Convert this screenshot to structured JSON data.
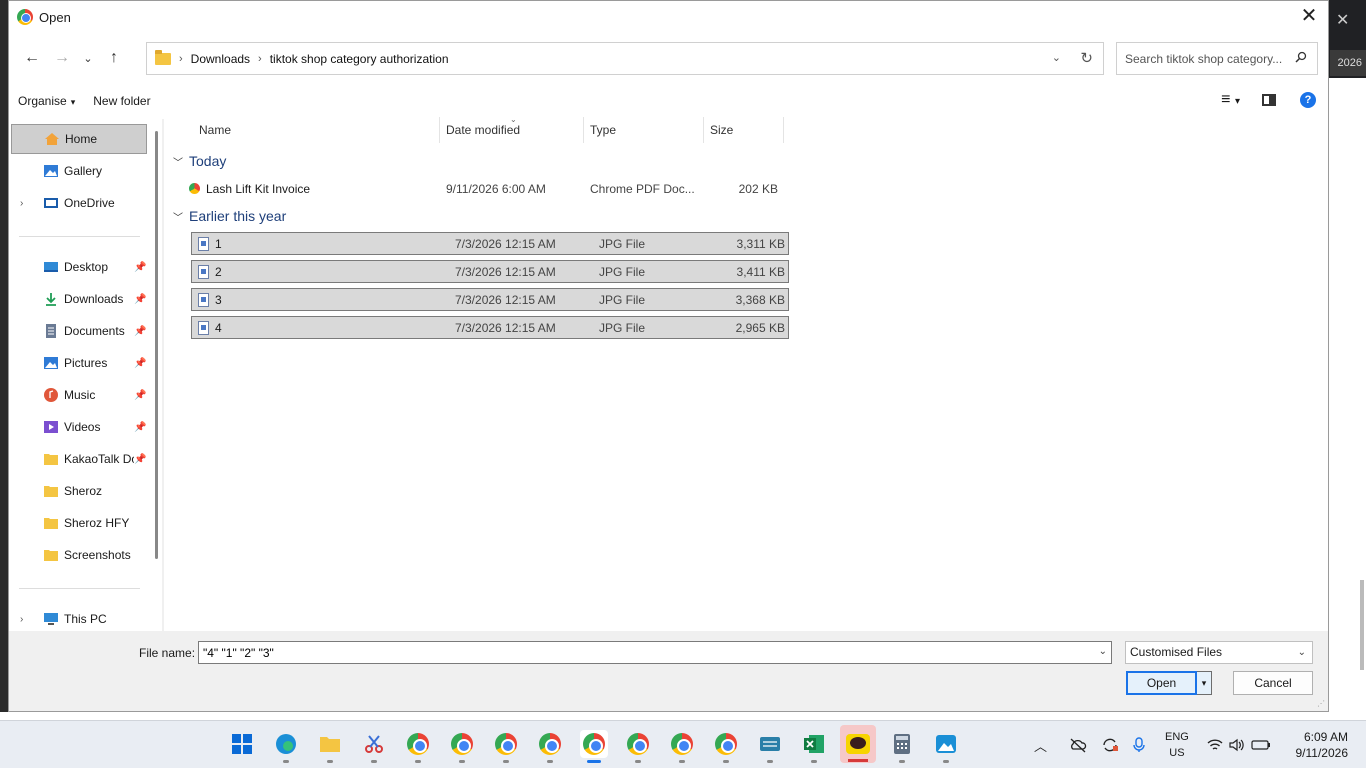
{
  "dialog": {
    "title": "Open",
    "close_glyph": "✕"
  },
  "background": {
    "close_glyph": "✕",
    "year_label": "2026"
  },
  "nav": {
    "back": "←",
    "forward": "→",
    "recent": "⌄",
    "up": "↑",
    "breadcrumbs": [
      "Downloads",
      "tiktok shop category authorization"
    ],
    "crumb_sep": "›",
    "refresh": "↻",
    "dropdown": "⌄",
    "search_placeholder": "Search tiktok shop category..."
  },
  "toolbar": {
    "organise": "Organise",
    "new_folder": "New folder",
    "caret": "▾",
    "view_glyph": "≡",
    "help": "?"
  },
  "sidebar": {
    "items": [
      {
        "label": "Home",
        "icon": "home-icon",
        "selected": true
      },
      {
        "label": "Gallery",
        "icon": "gallery-icon"
      },
      {
        "label": "OneDrive",
        "icon": "onedrive-icon",
        "expandable": true
      },
      {
        "label": "Desktop",
        "icon": "desktop-icon",
        "pinned": true
      },
      {
        "label": "Downloads",
        "icon": "download-icon",
        "pinned": true
      },
      {
        "label": "Documents",
        "icon": "documents-icon",
        "pinned": true
      },
      {
        "label": "Pictures",
        "icon": "pictures-icon",
        "pinned": true
      },
      {
        "label": "Music",
        "icon": "music-icon",
        "pinned": true
      },
      {
        "label": "Videos",
        "icon": "videos-icon",
        "pinned": true
      },
      {
        "label": "KakaoTalk Downloads",
        "icon": "folder-icon",
        "pinned": true
      },
      {
        "label": "Sheroz",
        "icon": "folder-icon"
      },
      {
        "label": "Sheroz HFY",
        "icon": "folder-icon"
      },
      {
        "label": "Screenshots",
        "icon": "folder-icon"
      },
      {
        "label": "This PC",
        "icon": "this-pc-icon",
        "expandable": true
      }
    ],
    "pin_glyph": "📌",
    "expander_glyph": "›"
  },
  "columns": {
    "name": "Name",
    "date": "Date modified",
    "type": "Type",
    "size": "Size"
  },
  "groups": {
    "today": {
      "label": "Today",
      "files": [
        {
          "name": "Lash Lift Kit Invoice",
          "date": "9/11/2026 6:00 AM",
          "type": "Chrome PDF Doc...",
          "size": "202 KB",
          "icon": "chrome-pdf-icon"
        }
      ]
    },
    "earlier": {
      "label": "Earlier this year",
      "files": [
        {
          "name": "1",
          "date": "7/3/2026 12:15 AM",
          "type": "JPG File",
          "size": "3,311 KB",
          "icon": "jpg-file-icon"
        },
        {
          "name": "2",
          "date": "7/3/2026 12:15 AM",
          "type": "JPG File",
          "size": "3,411 KB",
          "icon": "jpg-file-icon"
        },
        {
          "name": "3",
          "date": "7/3/2026 12:15 AM",
          "type": "JPG File",
          "size": "3,368 KB",
          "icon": "jpg-file-icon"
        },
        {
          "name": "4",
          "date": "7/3/2026 12:15 AM",
          "type": "JPG File",
          "size": "2,965 KB",
          "icon": "jpg-file-icon"
        }
      ]
    }
  },
  "bottom": {
    "file_name_label": "File name:",
    "file_name_value": "\"4\" \"1\" \"2\" \"3\"",
    "filter": "Customised Files",
    "open": "Open",
    "cancel": "Cancel"
  },
  "taskbar": {
    "lang_top": "ENG",
    "lang_bottom": "US",
    "time": "6:09 AM",
    "date": "9/11/2026"
  },
  "colors": {
    "accent": "#1a73e8",
    "group_header": "#1e3f7a",
    "selection": "#d9d9d9"
  }
}
